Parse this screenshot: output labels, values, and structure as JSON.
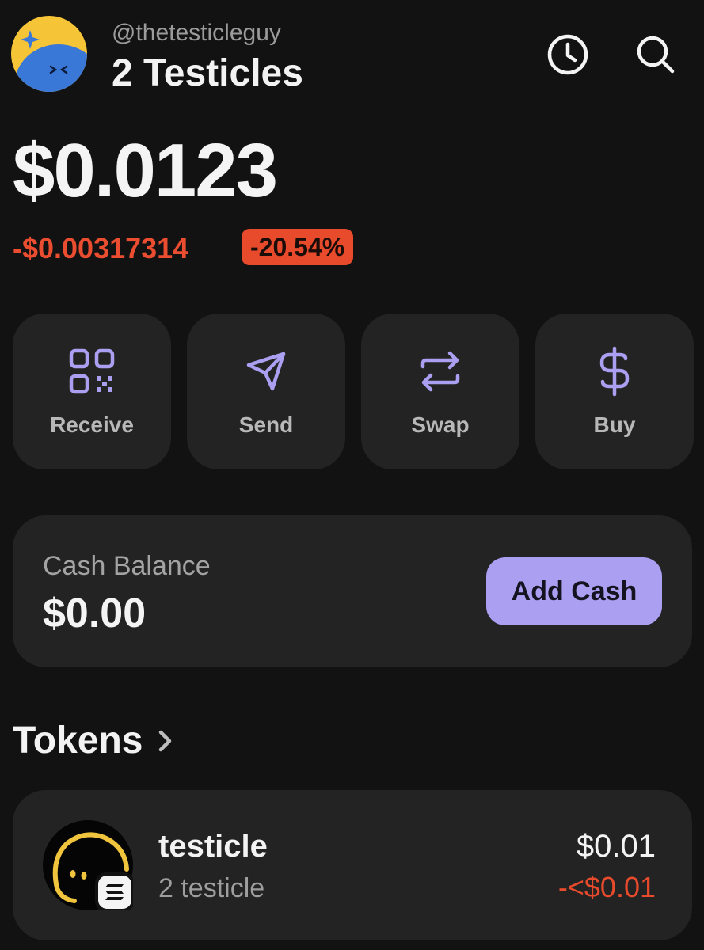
{
  "account": {
    "username": "@thetesticleguy",
    "name": "2 Testicles",
    "avatar_icon": "dizzy-face-avatar-icon"
  },
  "header_icons": {
    "history": "clock-icon",
    "search": "search-icon"
  },
  "portfolio": {
    "balance": "$0.0123",
    "change_amount": "-$0.00317314",
    "change_percent": "-20.54%"
  },
  "actions": [
    {
      "label": "Receive",
      "icon": "qr-code-icon"
    },
    {
      "label": "Send",
      "icon": "paper-plane-icon"
    },
    {
      "label": "Swap",
      "icon": "swap-arrows-icon"
    },
    {
      "label": "Buy",
      "icon": "dollar-icon"
    }
  ],
  "cash": {
    "label": "Cash Balance",
    "value": "$0.00",
    "button_label": "Add Cash"
  },
  "tokens": {
    "title": "Tokens",
    "items": [
      {
        "name": "testicle",
        "quantity": "2 testicle",
        "value": "$0.01",
        "change": "-<$0.01",
        "logo_icon": "testicle-token-logo",
        "chain_icon": "solana-chain-icon"
      }
    ]
  },
  "colors": {
    "background": "#121212",
    "card": "#232323",
    "accent": "#ab9ff2",
    "negative": "#e84a2c"
  }
}
